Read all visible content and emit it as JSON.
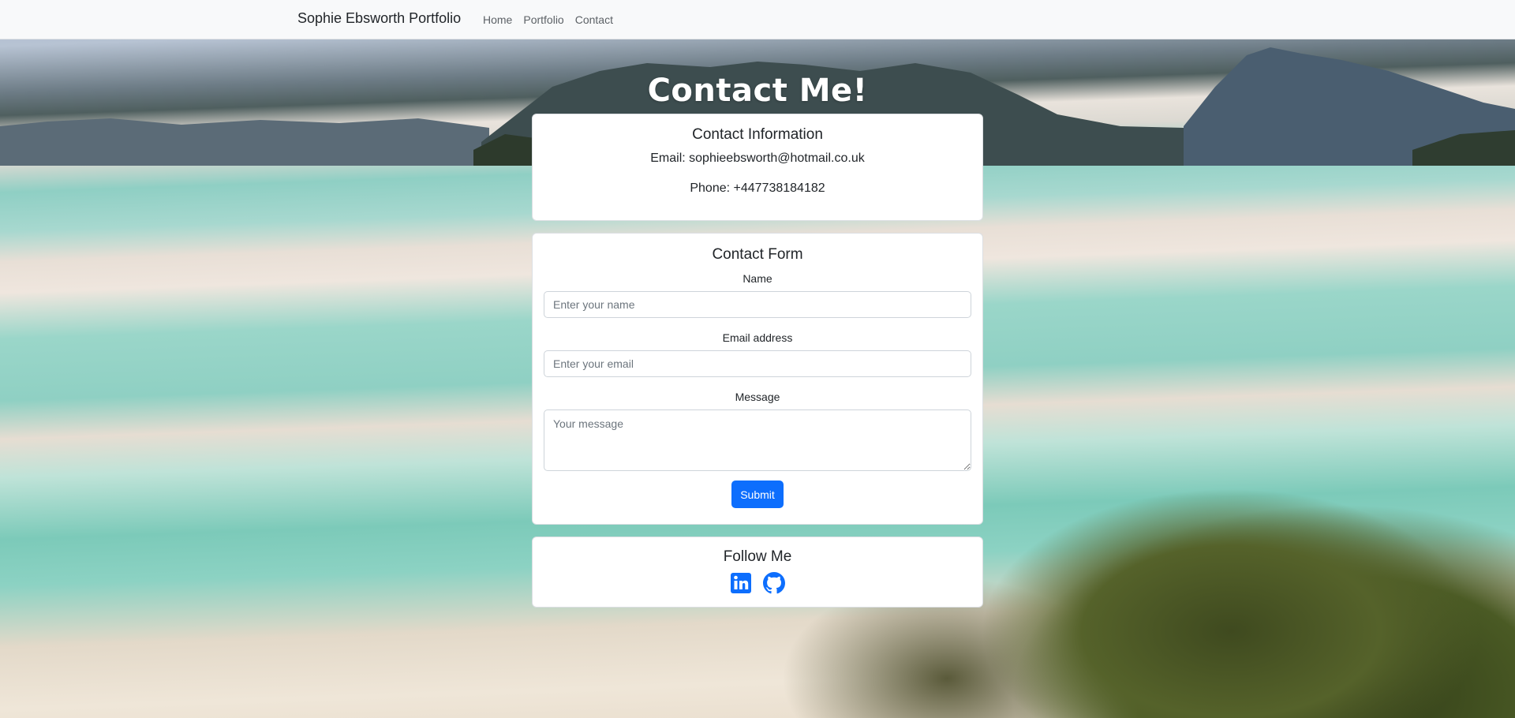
{
  "navbar": {
    "brand": "Sophie Ebsworth Portfolio",
    "links": [
      {
        "label": "Home"
      },
      {
        "label": "Portfolio"
      },
      {
        "label": "Contact"
      }
    ]
  },
  "page": {
    "heading": "Contact Me!"
  },
  "contact_info": {
    "title": "Contact Information",
    "email_line": "Email: sophieebsworth@hotmail.co.uk",
    "phone_line": "Phone: +447738184182"
  },
  "contact_form": {
    "title": "Contact Form",
    "name_label": "Name",
    "name_placeholder": "Enter your name",
    "name_value": "",
    "email_label": "Email address",
    "email_placeholder": "Enter your email",
    "email_value": "",
    "message_label": "Message",
    "message_placeholder": "Your message",
    "message_value": "",
    "submit_label": "Submit"
  },
  "follow": {
    "title": "Follow Me",
    "icons": [
      "linkedin-icon",
      "github-icon"
    ]
  },
  "colors": {
    "accent": "#0d6efd",
    "navbar_bg": "#f8f9fa",
    "card_bg": "#ffffff"
  }
}
